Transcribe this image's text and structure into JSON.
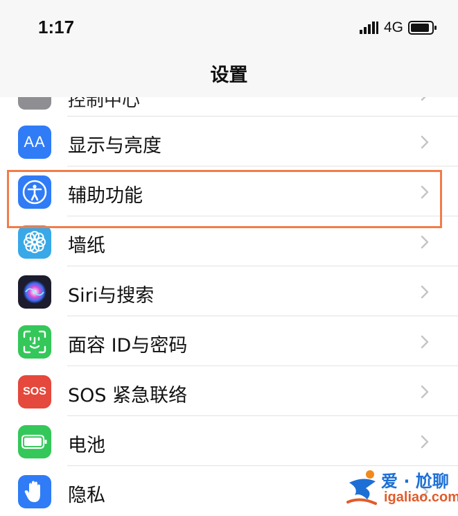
{
  "status_bar": {
    "time": "1:17",
    "network": "4G"
  },
  "nav": {
    "title": "设置"
  },
  "partial_row": {
    "label": "控制中心"
  },
  "settings": [
    {
      "label": "显示与亮度",
      "icon": "display-brightness-icon",
      "color": "#2f7cf6",
      "icon_text": "AA"
    },
    {
      "label": "辅助功能",
      "icon": "accessibility-icon",
      "color": "#2f7cf6",
      "icon_text": ""
    },
    {
      "label": "墙纸",
      "icon": "wallpaper-icon",
      "color": "#38a8e8",
      "icon_text": ""
    },
    {
      "label": "Siri与搜索",
      "icon": "siri-icon",
      "color": "#1c1c2e",
      "icon_text": ""
    },
    {
      "label": "面容 ID与密码",
      "icon": "face-id-icon",
      "color": "#34c759",
      "icon_text": ""
    },
    {
      "label": "SOS 紧急联络",
      "icon": "sos-icon",
      "color": "#e5483c",
      "icon_text": "SOS"
    },
    {
      "label": "电池",
      "icon": "battery-setting-icon",
      "color": "#34c759",
      "icon_text": ""
    },
    {
      "label": "隐私",
      "icon": "privacy-hand-icon",
      "color": "#2f7cf6",
      "icon_text": ""
    }
  ],
  "highlight_color": "#f27c48",
  "watermark": {
    "text": "爱 · 尬聊",
    "url": "igaliao.com"
  }
}
